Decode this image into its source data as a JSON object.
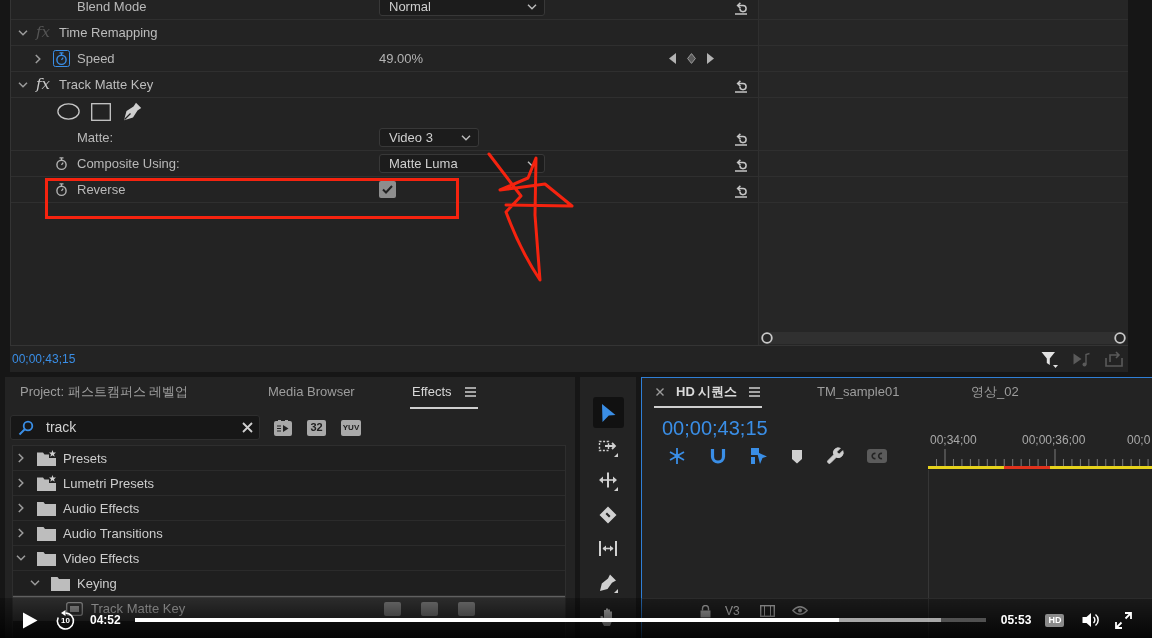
{
  "effect_controls": {
    "rows": [
      {
        "kind": "property",
        "label": "Blend Mode",
        "control": {
          "kind": "dropdown",
          "value": "Normal"
        },
        "reset": true
      },
      {
        "kind": "effect",
        "label": "Time Remapping",
        "expanded": true,
        "toggle": {
          "label": "fx",
          "enabled": false
        },
        "reset": false,
        "children": [
          {
            "kind": "property",
            "label": "Speed",
            "expanded": false,
            "stopwatch": {
              "on": true
            },
            "control": {
              "kind": "text",
              "value": "49.00%"
            },
            "keyframe_nav": true,
            "reset": false
          }
        ]
      },
      {
        "kind": "effect",
        "label": "Track Matte Key",
        "expanded": true,
        "toggle": {
          "label": "fx",
          "enabled": true
        },
        "reset": true,
        "children": [
          {
            "kind": "mask-tools"
          },
          {
            "kind": "property",
            "label": "Matte:",
            "control": {
              "kind": "track-dropdown",
              "value": "Video 3"
            },
            "reset": true
          },
          {
            "kind": "property",
            "label": "Composite Using:",
            "stopwatch": {
              "on": false
            },
            "control": {
              "kind": "dropdown",
              "value": "Matte Luma"
            },
            "reset": true
          },
          {
            "kind": "property",
            "label": "Reverse",
            "stopwatch": {
              "on": false
            },
            "control": {
              "kind": "checkbox",
              "checked": true
            },
            "reset": true
          }
        ]
      }
    ],
    "timecode": "00;00;43;15",
    "footer_tools": [
      {
        "kind": "filter",
        "disabled": false
      },
      {
        "kind": "loop-audio",
        "disabled": true
      },
      {
        "kind": "export",
        "disabled": true
      }
    ]
  },
  "effects_panel": {
    "tabs": [
      {
        "label": "Project: 패스트캠퍼스 레벨업",
        "selected": false
      },
      {
        "label": "Media Browser",
        "selected": false
      },
      {
        "label": "Effects",
        "selected": true
      }
    ],
    "search": {
      "value": "track"
    },
    "filters": [
      {
        "kind": "accelerated"
      },
      {
        "kind": "bit-depth",
        "label": "32"
      },
      {
        "kind": "yuv",
        "label": "YUV"
      }
    ],
    "tree": [
      {
        "kind": "preset-folder",
        "label": "Presets",
        "expanded": false,
        "selected": false
      },
      {
        "kind": "preset-folder",
        "label": "Lumetri Presets",
        "expanded": false,
        "selected": false
      },
      {
        "kind": "folder",
        "label": "Audio Effects",
        "expanded": false,
        "selected": false
      },
      {
        "kind": "folder",
        "label": "Audio Transitions",
        "expanded": false,
        "selected": false
      },
      {
        "kind": "folder",
        "label": "Video Effects",
        "expanded": true,
        "selected": false,
        "children": [
          {
            "kind": "folder",
            "label": "Keying",
            "expanded": true,
            "selected": false,
            "children": [
              {
                "kind": "effect",
                "label": "Track Matte Key",
                "selected": true
              }
            ]
          }
        ]
      }
    ]
  },
  "tools": [
    {
      "kind": "selection",
      "selected": true
    },
    {
      "kind": "track-select",
      "selected": false
    },
    {
      "kind": "ripple-edit",
      "selected": false
    },
    {
      "kind": "razor",
      "selected": false
    },
    {
      "kind": "slip",
      "selected": false
    },
    {
      "kind": "pen",
      "selected": false
    },
    {
      "kind": "hand",
      "selected": false
    }
  ],
  "timeline": {
    "tabs": [
      {
        "label": "HD 시퀀스",
        "selected": true
      },
      {
        "label": "TM_sample01",
        "selected": false
      },
      {
        "label": "영상_02",
        "selected": false
      }
    ],
    "timecode": "00;00;43;15",
    "controls": [
      {
        "kind": "nest",
        "on": true,
        "disabled": false
      },
      {
        "kind": "snap",
        "on": true,
        "disabled": false
      },
      {
        "kind": "linked-selection",
        "on": true,
        "disabled": false
      },
      {
        "kind": "marker",
        "on": false,
        "disabled": false
      },
      {
        "kind": "settings",
        "on": false,
        "disabled": false
      },
      {
        "kind": "captions",
        "disabled": true
      }
    ],
    "ruler_labels": [
      "00;34;00",
      "00;00;36;00",
      "00;0"
    ],
    "tracks": [
      {
        "label": "V3"
      }
    ]
  },
  "player": {
    "playing": false,
    "rewind_label": "10",
    "elapsed": "04:52",
    "progress": {
      "level": 0.828,
      "buffered": {
        "level": 0.947
      }
    },
    "duration": "05:53",
    "quality": "HD"
  },
  "annotations": {
    "highlight_box": true,
    "scribble": true
  }
}
